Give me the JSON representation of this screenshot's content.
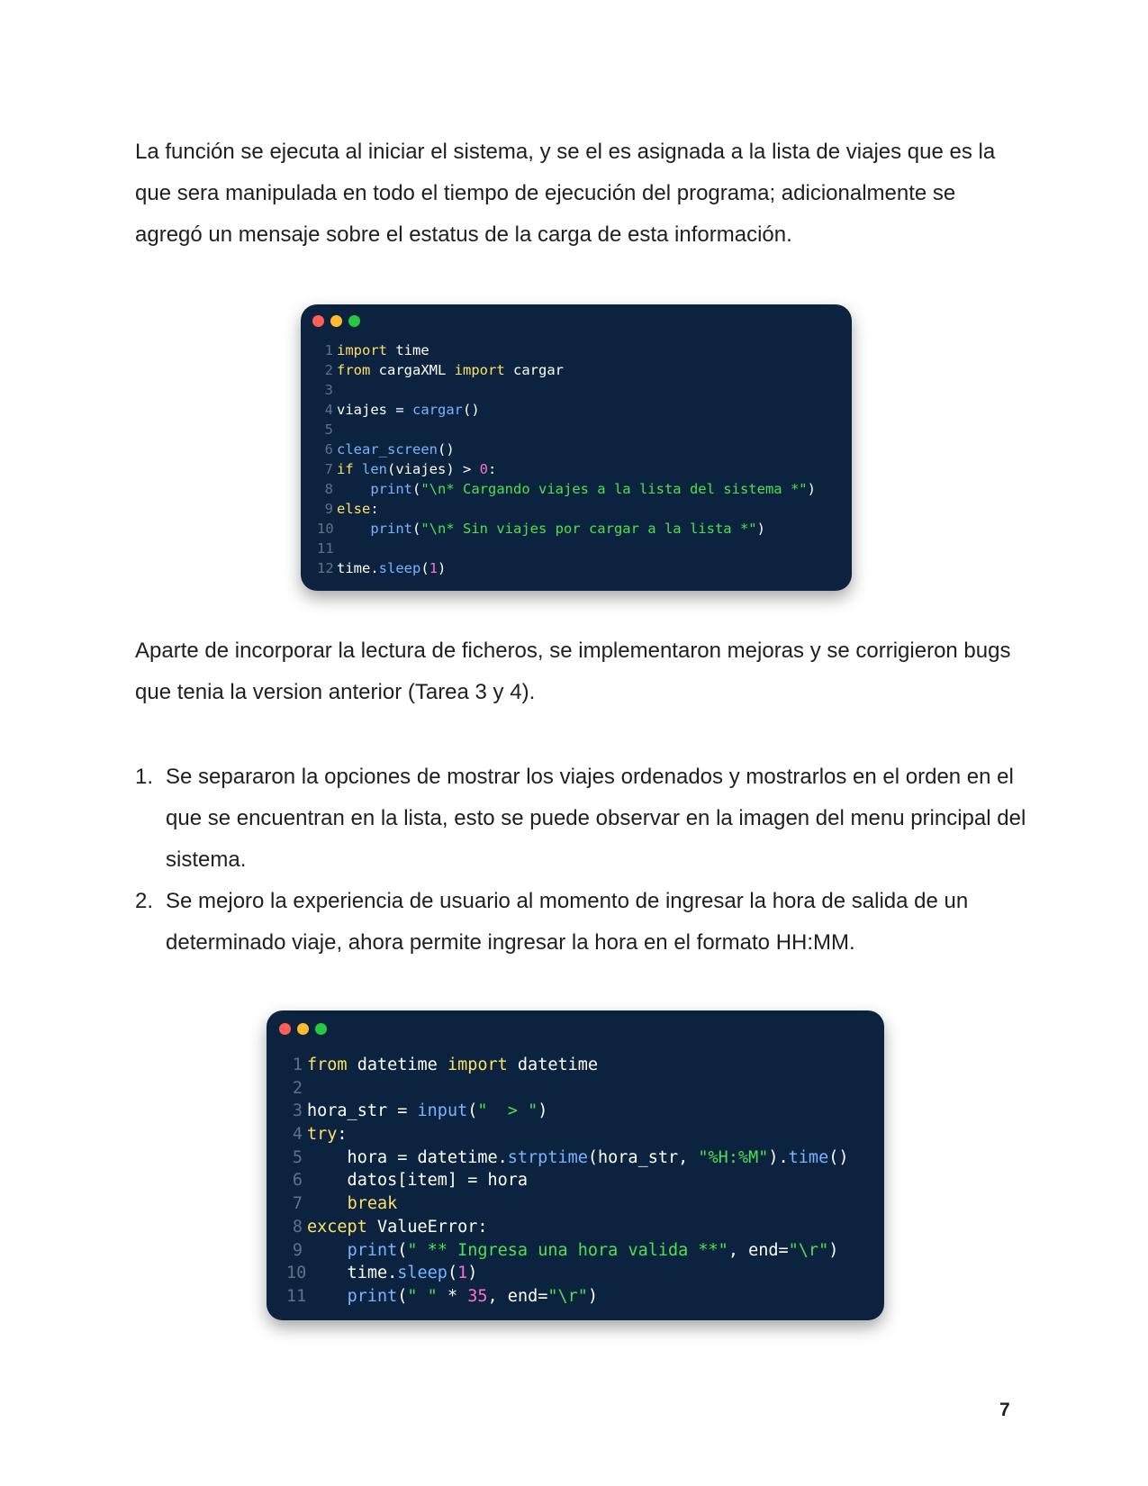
{
  "paragraph1": "La función se ejecuta al iniciar el sistema, y se el es asignada a la lista de viajes que es la que sera manipulada en todo el tiempo de ejecución del programa; adicionalmente se agregó un mensaje sobre el estatus de la carga de esta información.",
  "paragraph2": "Aparte de incorporar la lectura de ficheros, se implementaron mejoras y se corrigieron bugs que tenia la version anterior (Tarea 3 y 4).",
  "list": [
    {
      "number": "1.",
      "text": "Se separaron la opciones de mostrar los viajes ordenados y mostrarlos  en el orden en el que se encuentran en la lista, esto se puede observar en la imagen del menu principal del sistema."
    },
    {
      "number": "2.",
      "text": "Se mejoro la experiencia de usuario al momento de ingresar la hora de salida de un determinado viaje, ahora permite ingresar la hora en el formato HH:MM."
    }
  ],
  "code_block_1": {
    "lines": [
      {
        "n": "1",
        "tokens": [
          {
            "t": "import",
            "c": "kw"
          },
          {
            "t": " time",
            "c": "pl"
          }
        ]
      },
      {
        "n": "2",
        "tokens": [
          {
            "t": "from",
            "c": "kw"
          },
          {
            "t": " cargaXML ",
            "c": "pl"
          },
          {
            "t": "import",
            "c": "kw"
          },
          {
            "t": " cargar",
            "c": "pl"
          }
        ]
      },
      {
        "n": "3",
        "tokens": []
      },
      {
        "n": "4",
        "tokens": [
          {
            "t": "viajes = ",
            "c": "pl"
          },
          {
            "t": "cargar",
            "c": "fn"
          },
          {
            "t": "()",
            "c": "pl"
          }
        ]
      },
      {
        "n": "5",
        "tokens": []
      },
      {
        "n": "6",
        "tokens": [
          {
            "t": "clear_screen",
            "c": "fn"
          },
          {
            "t": "()",
            "c": "pl"
          }
        ]
      },
      {
        "n": "7",
        "tokens": [
          {
            "t": "if",
            "c": "kw"
          },
          {
            "t": " ",
            "c": "pl"
          },
          {
            "t": "len",
            "c": "fn"
          },
          {
            "t": "(viajes) > ",
            "c": "pl"
          },
          {
            "t": "0",
            "c": "nu"
          },
          {
            "t": ":",
            "c": "pl"
          }
        ]
      },
      {
        "n": "8",
        "tokens": [
          {
            "t": "    ",
            "c": "pl"
          },
          {
            "t": "print",
            "c": "fn"
          },
          {
            "t": "(",
            "c": "pl"
          },
          {
            "t": "\"\\n* Cargando viajes a la lista del sistema *\"",
            "c": "st"
          },
          {
            "t": ")",
            "c": "pl"
          }
        ]
      },
      {
        "n": "9",
        "tokens": [
          {
            "t": "else",
            "c": "kw"
          },
          {
            "t": ":",
            "c": "pl"
          }
        ]
      },
      {
        "n": "10",
        "tokens": [
          {
            "t": "    ",
            "c": "pl"
          },
          {
            "t": "print",
            "c": "fn"
          },
          {
            "t": "(",
            "c": "pl"
          },
          {
            "t": "\"\\n* Sin viajes por cargar a la lista *\"",
            "c": "st"
          },
          {
            "t": ")",
            "c": "pl"
          }
        ]
      },
      {
        "n": "11",
        "tokens": []
      },
      {
        "n": "12",
        "tokens": [
          {
            "t": "time.",
            "c": "pl"
          },
          {
            "t": "sleep",
            "c": "fn"
          },
          {
            "t": "(",
            "c": "pl"
          },
          {
            "t": "1",
            "c": "nu"
          },
          {
            "t": ")",
            "c": "pl"
          }
        ]
      }
    ]
  },
  "code_block_2": {
    "lines": [
      {
        "n": "1",
        "tokens": [
          {
            "t": "from",
            "c": "kw"
          },
          {
            "t": " datetime ",
            "c": "pl"
          },
          {
            "t": "import",
            "c": "kw"
          },
          {
            "t": " datetime",
            "c": "pl"
          }
        ]
      },
      {
        "n": "2",
        "tokens": []
      },
      {
        "n": "3",
        "tokens": [
          {
            "t": "hora_str = ",
            "c": "pl"
          },
          {
            "t": "input",
            "c": "fn"
          },
          {
            "t": "(",
            "c": "pl"
          },
          {
            "t": "\"  > \"",
            "c": "st"
          },
          {
            "t": ")",
            "c": "pl"
          }
        ]
      },
      {
        "n": "4",
        "tokens": [
          {
            "t": "try",
            "c": "kw"
          },
          {
            "t": ":",
            "c": "pl"
          }
        ]
      },
      {
        "n": "5",
        "tokens": [
          {
            "t": "    hora = datetime.",
            "c": "pl"
          },
          {
            "t": "strptime",
            "c": "fn"
          },
          {
            "t": "(hora_str, ",
            "c": "pl"
          },
          {
            "t": "\"%H:%M\"",
            "c": "st"
          },
          {
            "t": ").",
            "c": "pl"
          },
          {
            "t": "time",
            "c": "fn"
          },
          {
            "t": "()",
            "c": "pl"
          }
        ]
      },
      {
        "n": "6",
        "tokens": [
          {
            "t": "    datos[item] = hora",
            "c": "pl"
          }
        ]
      },
      {
        "n": "7",
        "tokens": [
          {
            "t": "    ",
            "c": "pl"
          },
          {
            "t": "break",
            "c": "kw"
          }
        ]
      },
      {
        "n": "8",
        "tokens": [
          {
            "t": "except",
            "c": "kw"
          },
          {
            "t": " ValueError:",
            "c": "pl"
          }
        ]
      },
      {
        "n": "9",
        "tokens": [
          {
            "t": "    ",
            "c": "pl"
          },
          {
            "t": "print",
            "c": "fn"
          },
          {
            "t": "(",
            "c": "pl"
          },
          {
            "t": "\" ** Ingresa una hora valida **\"",
            "c": "st"
          },
          {
            "t": ", end=",
            "c": "pl"
          },
          {
            "t": "\"\\r\"",
            "c": "st"
          },
          {
            "t": ")",
            "c": "pl"
          }
        ]
      },
      {
        "n": "10",
        "tokens": [
          {
            "t": "    time.",
            "c": "pl"
          },
          {
            "t": "sleep",
            "c": "fn"
          },
          {
            "t": "(",
            "c": "pl"
          },
          {
            "t": "1",
            "c": "nu"
          },
          {
            "t": ")",
            "c": "pl"
          }
        ]
      },
      {
        "n": "11",
        "tokens": [
          {
            "t": "    ",
            "c": "pl"
          },
          {
            "t": "print",
            "c": "fn"
          },
          {
            "t": "(",
            "c": "pl"
          },
          {
            "t": "\" \"",
            "c": "st"
          },
          {
            "t": " * ",
            "c": "pl"
          },
          {
            "t": "35",
            "c": "nu"
          },
          {
            "t": ", end=",
            "c": "pl"
          },
          {
            "t": "\"\\r\"",
            "c": "st"
          },
          {
            "t": ")",
            "c": "pl"
          }
        ]
      }
    ]
  },
  "page_number": "7"
}
